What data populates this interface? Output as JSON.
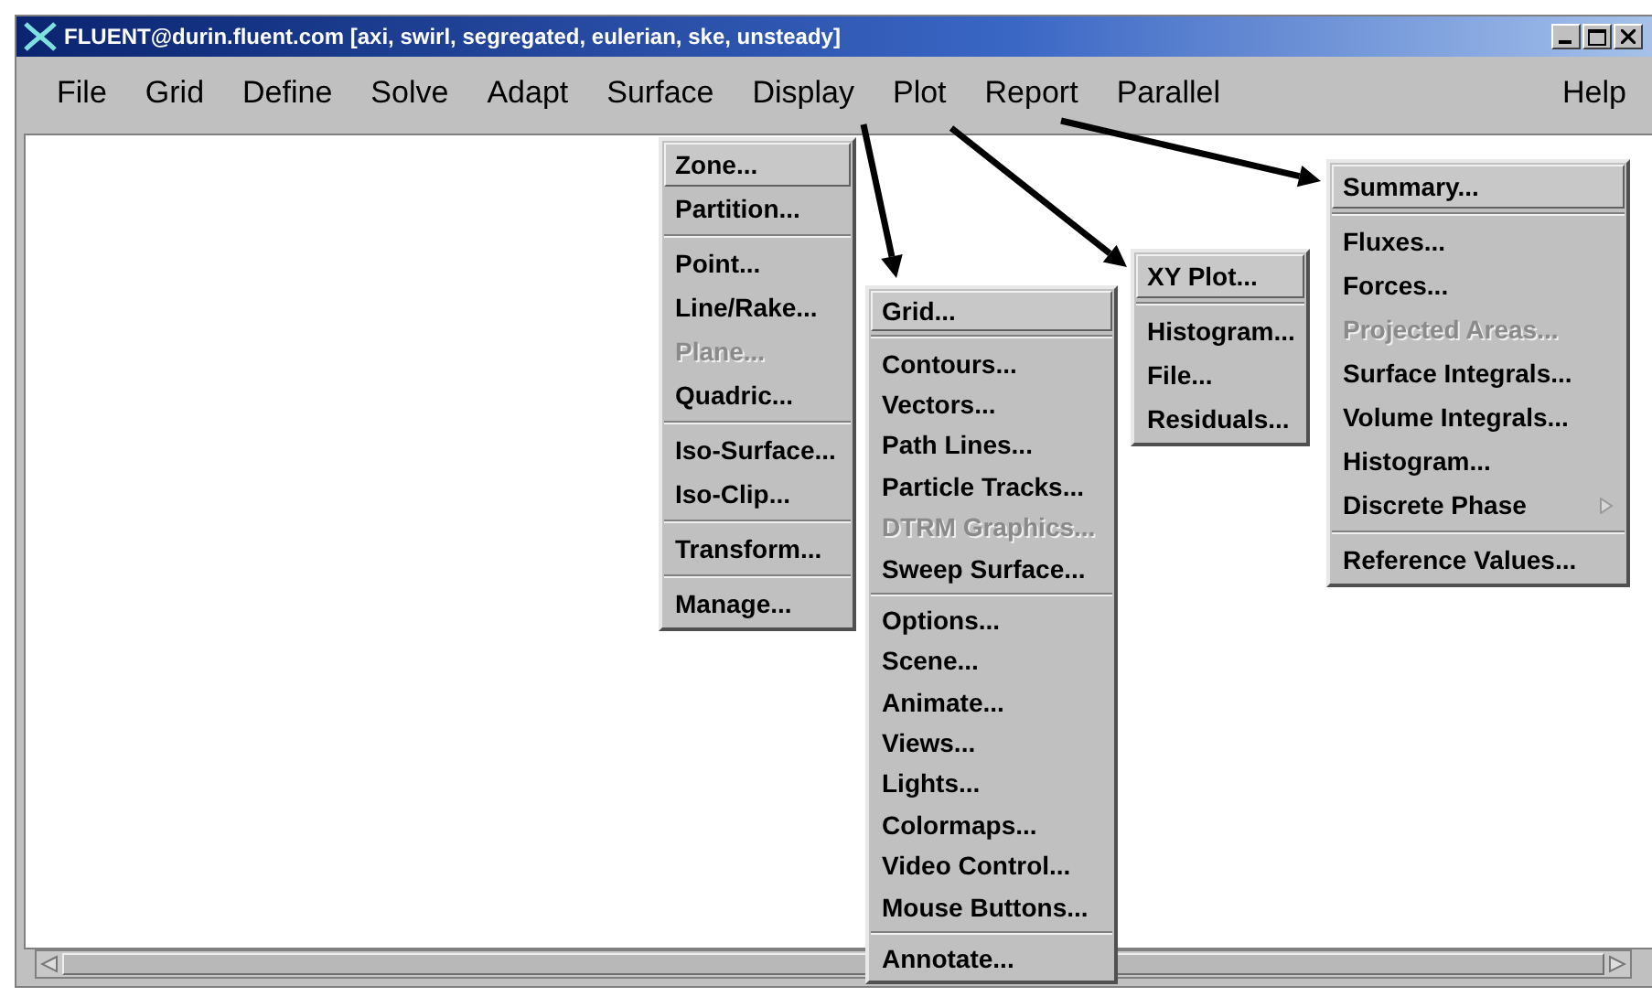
{
  "window": {
    "title": "FLUENT@durin.fluent.com  [axi, swirl, segregated, eulerian, ske, unsteady]"
  },
  "menu_bar": {
    "items": [
      {
        "label": "File"
      },
      {
        "label": "Grid"
      },
      {
        "label": "Define"
      },
      {
        "label": "Solve"
      },
      {
        "label": "Adapt"
      },
      {
        "label": "Surface"
      },
      {
        "label": "Display"
      },
      {
        "label": "Plot"
      },
      {
        "label": "Report"
      },
      {
        "label": "Parallel"
      }
    ],
    "help": "Help"
  },
  "menus": [
    {
      "items": [
        {
          "kind": "item",
          "label": "Zone...",
          "selected": true,
          "disabled": false
        },
        {
          "kind": "item",
          "label": "Partition...",
          "selected": false,
          "disabled": false
        },
        {
          "kind": "separator"
        },
        {
          "kind": "item",
          "label": "Point...",
          "selected": false,
          "disabled": false
        },
        {
          "kind": "item",
          "label": "Line/Rake...",
          "selected": false,
          "disabled": false
        },
        {
          "kind": "item",
          "label": "Plane...",
          "selected": false,
          "disabled": true
        },
        {
          "kind": "item",
          "label": "Quadric...",
          "selected": false,
          "disabled": false
        },
        {
          "kind": "separator"
        },
        {
          "kind": "item",
          "label": "Iso-Surface...",
          "selected": false,
          "disabled": false
        },
        {
          "kind": "item",
          "label": "Iso-Clip...",
          "selected": false,
          "disabled": false
        },
        {
          "kind": "separator"
        },
        {
          "kind": "item",
          "label": "Transform...",
          "selected": false,
          "disabled": false
        },
        {
          "kind": "separator"
        },
        {
          "kind": "item",
          "label": "Manage...",
          "selected": false,
          "disabled": false
        }
      ]
    },
    {
      "items": [
        {
          "kind": "item",
          "label": "Grid...",
          "selected": true,
          "disabled": false
        },
        {
          "kind": "separator"
        },
        {
          "kind": "item",
          "label": "Contours...",
          "selected": false,
          "disabled": false
        },
        {
          "kind": "item",
          "label": "Vectors...",
          "selected": false,
          "disabled": false
        },
        {
          "kind": "item",
          "label": "Path Lines...",
          "selected": false,
          "disabled": false
        },
        {
          "kind": "item",
          "label": "Particle Tracks...",
          "selected": false,
          "disabled": false
        },
        {
          "kind": "item",
          "label": "DTRM Graphics...",
          "selected": false,
          "disabled": true
        },
        {
          "kind": "item",
          "label": "Sweep Surface...",
          "selected": false,
          "disabled": false
        },
        {
          "kind": "separator"
        },
        {
          "kind": "item",
          "label": "Options...",
          "selected": false,
          "disabled": false
        },
        {
          "kind": "item",
          "label": "Scene...",
          "selected": false,
          "disabled": false
        },
        {
          "kind": "item",
          "label": "Animate...",
          "selected": false,
          "disabled": false
        },
        {
          "kind": "item",
          "label": "Views...",
          "selected": false,
          "disabled": false
        },
        {
          "kind": "item",
          "label": "Lights...",
          "selected": false,
          "disabled": false
        },
        {
          "kind": "item",
          "label": "Colormaps...",
          "selected": false,
          "disabled": false
        },
        {
          "kind": "item",
          "label": "Video Control...",
          "selected": false,
          "disabled": false
        },
        {
          "kind": "item",
          "label": "Mouse Buttons...",
          "selected": false,
          "disabled": false
        },
        {
          "kind": "separator"
        },
        {
          "kind": "item",
          "label": "Annotate...",
          "selected": false,
          "disabled": false
        }
      ]
    },
    {
      "items": [
        {
          "kind": "item",
          "label": "XY Plot...",
          "selected": true,
          "disabled": false
        },
        {
          "kind": "separator"
        },
        {
          "kind": "item",
          "label": "Histogram...",
          "selected": false,
          "disabled": false
        },
        {
          "kind": "item",
          "label": "File...",
          "selected": false,
          "disabled": false
        },
        {
          "kind": "item",
          "label": "Residuals...",
          "selected": false,
          "disabled": false
        }
      ]
    },
    {
      "items": [
        {
          "kind": "item",
          "label": "Summary...",
          "selected": true,
          "disabled": false
        },
        {
          "kind": "separator"
        },
        {
          "kind": "item",
          "label": "Fluxes...",
          "selected": false,
          "disabled": false
        },
        {
          "kind": "item",
          "label": "Forces...",
          "selected": false,
          "disabled": false
        },
        {
          "kind": "item",
          "label": "Projected Areas...",
          "selected": false,
          "disabled": true
        },
        {
          "kind": "item",
          "label": "Surface Integrals...",
          "selected": false,
          "disabled": false
        },
        {
          "kind": "item",
          "label": "Volume Integrals...",
          "selected": false,
          "disabled": false
        },
        {
          "kind": "item",
          "label": "Histogram...",
          "selected": false,
          "disabled": false
        },
        {
          "kind": "submenu",
          "label": "Discrete Phase",
          "selected": false,
          "disabled": false
        },
        {
          "kind": "separator"
        },
        {
          "kind": "item",
          "label": "Reference Values...",
          "selected": false,
          "disabled": false
        }
      ]
    }
  ]
}
